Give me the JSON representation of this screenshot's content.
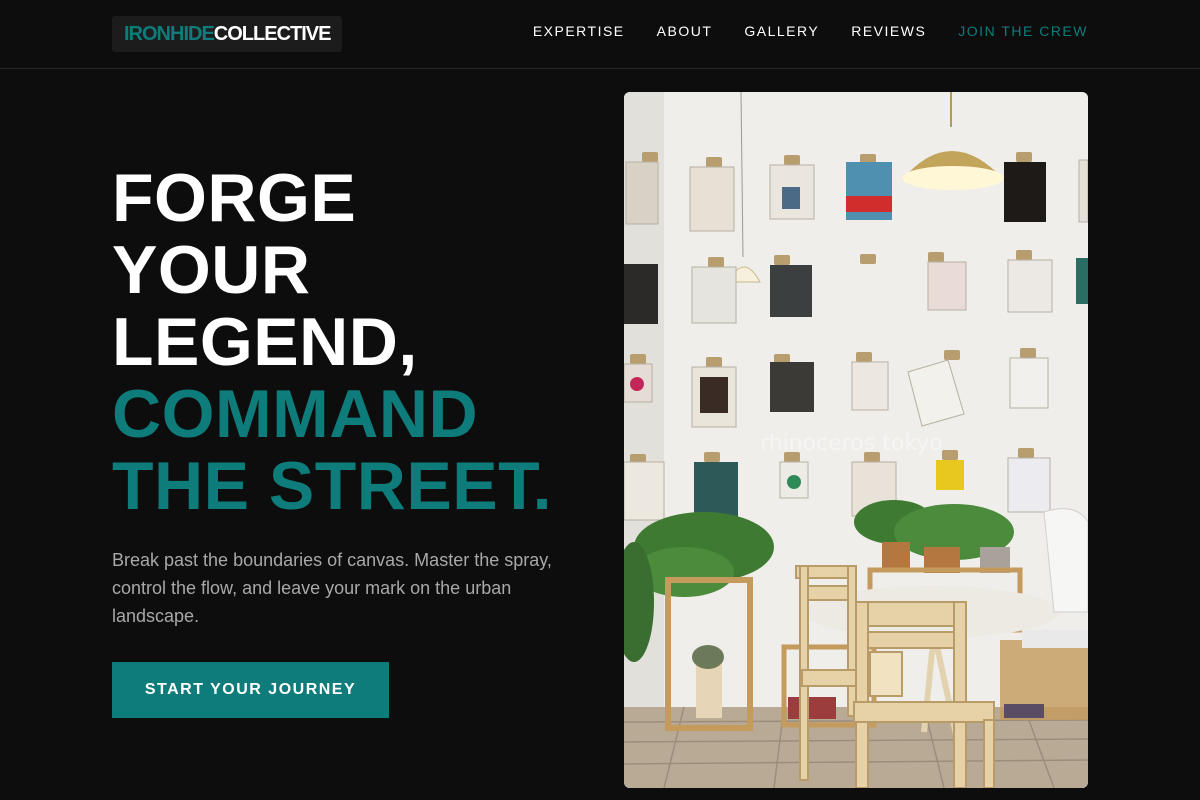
{
  "header": {
    "logo_part1": "IRONHIDE",
    "logo_part2": "COLLECTIVE",
    "nav": [
      "EXPERTISE",
      "ABOUT",
      "GALLERY",
      "REVIEWS"
    ],
    "nav_cta": "JOIN THE CREW"
  },
  "hero": {
    "headline_white": [
      "FORGE",
      "YOUR",
      "LEGEND,"
    ],
    "headline_teal": [
      "COMMAND",
      "THE STREET."
    ],
    "description": "Break past the boundaries of canvas. Master the spray, control the flow, and leave your mark on the urban landscape.",
    "button_label": "START YOUR JOURNEY"
  },
  "photo": {
    "watermark": "rhinoceros tokyo"
  },
  "colors": {
    "accent": "#0e7c7b",
    "background": "#0d0d0d",
    "muted_text": "#a8a8a8"
  }
}
